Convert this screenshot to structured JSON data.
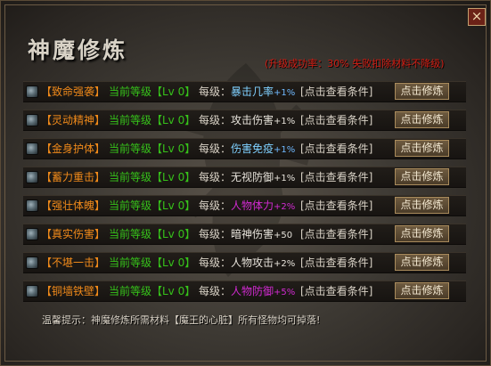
{
  "window": {
    "title": "神魔修炼",
    "close": "×",
    "notice": "(升级成功率：30% 失败扣除材料不降级)"
  },
  "colors": {
    "name": "#f08a1a",
    "level": "#36c21a",
    "notice": "#d11b12",
    "button_bg": "#5c4a33"
  },
  "rows": [
    {
      "name": "【致命强袭】",
      "level": "当前等级【Lv 0】",
      "bonus_label": "每级：",
      "stat": "暴击几率",
      "amount": "+1%",
      "stat_color": "sky",
      "condition": "[点击查看条件]",
      "button": "点击修炼"
    },
    {
      "name": "【灵动精神】",
      "level": "当前等级【Lv 0】",
      "bonus_label": "每级：",
      "stat": "攻击伤害",
      "amount": "+1%",
      "stat_color": "white",
      "condition": "[点击查看条件]",
      "button": "点击修炼"
    },
    {
      "name": "【金身护体】",
      "level": "当前等级【Lv 0】",
      "bonus_label": "每级：",
      "stat": "伤害免疫",
      "amount": "+1%",
      "stat_color": "sky",
      "condition": "[点击查看条件]",
      "button": "点击修炼"
    },
    {
      "name": "【蓄力重击】",
      "level": "当前等级【Lv 0】",
      "bonus_label": "每级：",
      "stat": "无视防御",
      "amount": "+1%",
      "stat_color": "white",
      "condition": "[点击查看条件]",
      "button": "点击修炼"
    },
    {
      "name": "【强壮体魄】",
      "level": "当前等级【Lv 0】",
      "bonus_label": "每级：",
      "stat": "人物体力",
      "amount": "+2%",
      "stat_color": "purple",
      "condition": "[点击查看条件]",
      "button": "点击修炼"
    },
    {
      "name": "【真实伤害】",
      "level": "当前等级【Lv 0】",
      "bonus_label": "每级：",
      "stat": "暗神伤害",
      "amount": "+50",
      "stat_color": "white",
      "condition": "[点击查看条件]",
      "button": "点击修炼"
    },
    {
      "name": "【不堪一击】",
      "level": "当前等级【Lv 0】",
      "bonus_label": "每级：",
      "stat": "人物攻击",
      "amount": "+2%",
      "stat_color": "white",
      "condition": "[点击查看条件]",
      "button": "点击修炼"
    },
    {
      "name": "【铜墙铁壁】",
      "level": "当前等级【Lv 0】",
      "bonus_label": "每级：",
      "stat": "人物防御",
      "amount": "+5%",
      "stat_color": "purple",
      "condition": "[点击查看条件]",
      "button": "点击修炼"
    }
  ],
  "tip": "温馨提示：神魔修炼所需材料【魔王的心脏】所有怪物均可掉落!"
}
